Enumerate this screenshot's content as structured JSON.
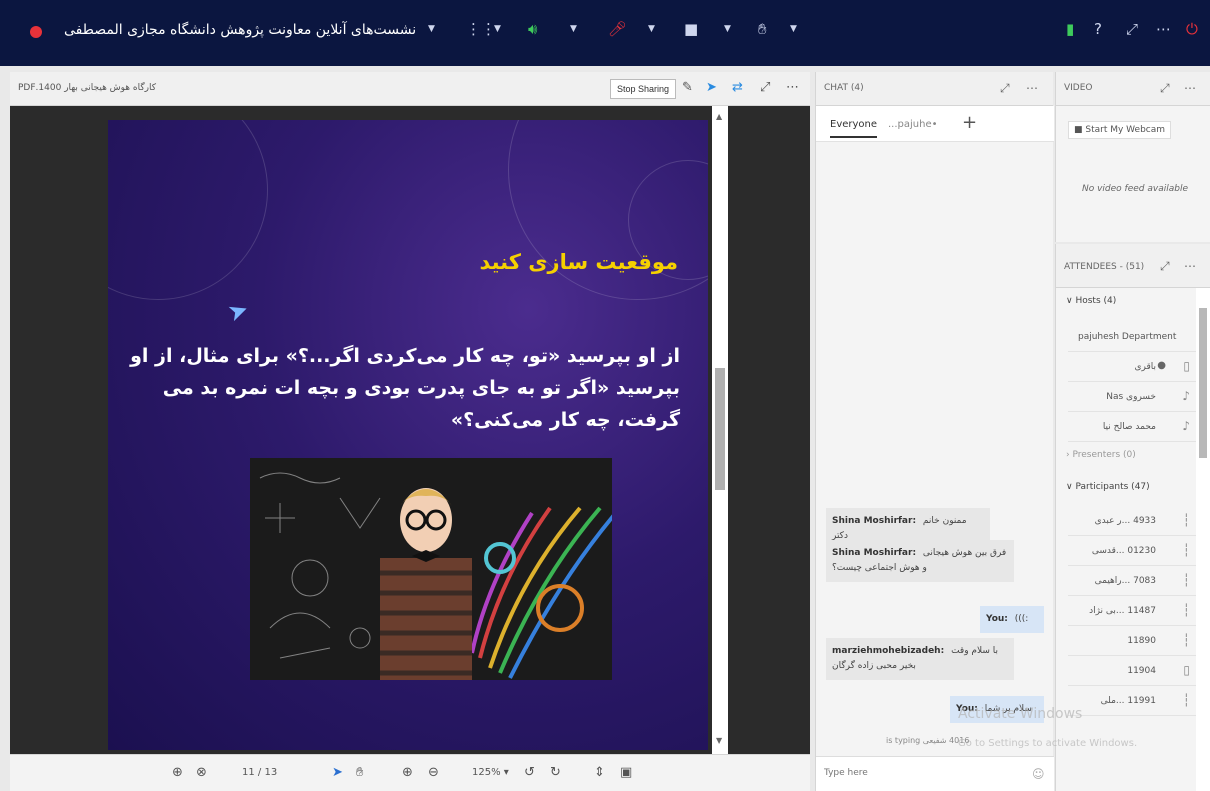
{
  "topbar": {
    "meeting_title": "نشست‌های آنلاین معاونت پژوهش دانشگاه مجازی المصطفی"
  },
  "presentation": {
    "doc_name": "کارگاه هوش هیجانی بهار 1400.PDF",
    "stop_sharing": "Stop Sharing",
    "slide_title": "موقعیت سازی کنید",
    "slide_text": "از او بپرسید «تو، چه کار می‌کردی اگر...؟» برای مثال، از او بپرسید «اگر تو به جای پدرت بودی و بچه ات نمره بد می گرفت، چه کار می‌کنی؟»",
    "page_current": "11",
    "page_total": "13",
    "zoom": "125%"
  },
  "chat": {
    "title": "CHAT",
    "title_count": "(4)",
    "tabs": {
      "everyone": "Everyone",
      "private": "•pajuhe..."
    },
    "messages": [
      {
        "sender": "Shina Moshirfar:",
        "text": "ممنون خانم دکتر"
      },
      {
        "sender": "Shina Moshirfar:",
        "text": "فرق بین هوش هیجانی و هوش اجتماعی چیست؟"
      },
      {
        "sender": "You:",
        "text": ":)))"
      },
      {
        "sender": "marziehmohebizadeh:",
        "text": "با سلام وقت بخیر محبی زاده گرگان"
      },
      {
        "sender": "You:",
        "text": "سلام بر شما"
      }
    ],
    "typing": "4016 شفیعی is typing",
    "input_placeholder": "Type here"
  },
  "video": {
    "title": "VIDEO",
    "start_webcam": "Start My Webcam",
    "no_feed": "No video feed available"
  },
  "attendees": {
    "title": "ATTENDEES",
    "count": "(51)",
    "hosts_label": "Hosts (4)",
    "presenters_label": "Presenters (0)",
    "participants_label": "Participants (47)",
    "hosts": [
      "pajuhesh Department",
      "باقری",
      "خسروی Nas",
      "محمد صالح نیا"
    ],
    "participants": [
      "4933 ...ر عبدی",
      "01230 ...قدسی",
      "7083 ...راهیمی",
      "11487 ...بی نژاد",
      "11890",
      "11904",
      "11991 ...ملی"
    ]
  },
  "watermark": {
    "line1": "Activate Windows",
    "line2": "Go to Settings to activate Windows."
  }
}
